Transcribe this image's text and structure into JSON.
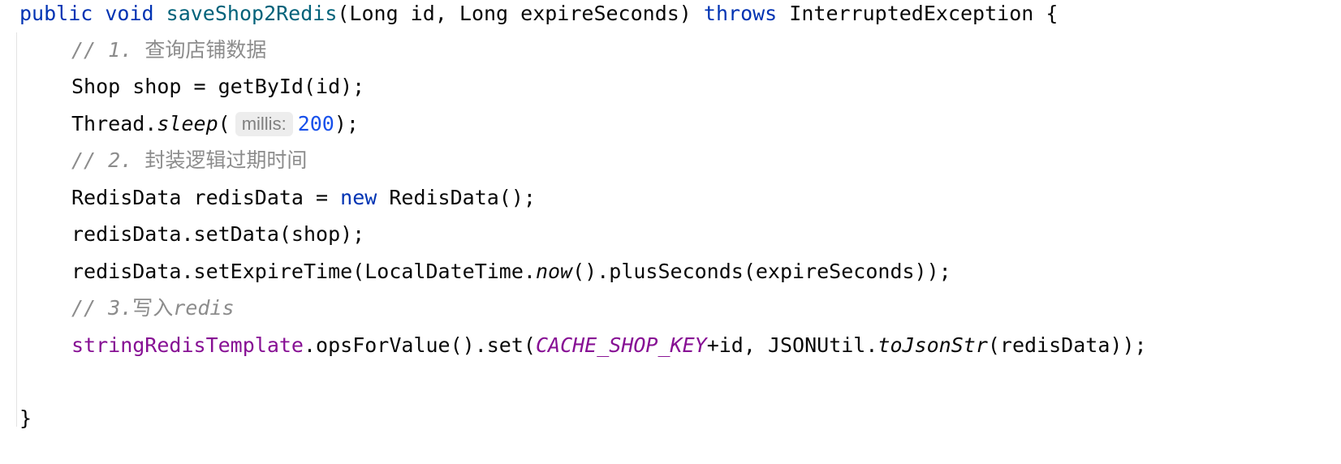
{
  "code": {
    "line1": {
      "kw_public": "public",
      "kw_void": "void",
      "method_name": "saveShop2Redis",
      "params": "(Long id, Long expireSeconds) ",
      "kw_throws": "throws",
      "rest": " InterruptedException {"
    },
    "line2": {
      "comment_prefix": "// 1. ",
      "comment_text": "查询店铺数据"
    },
    "line3": {
      "text": "Shop shop = getById(id);"
    },
    "line4": {
      "prefix": "Thread.",
      "method": "sleep",
      "open": "(",
      "hint": "millis:",
      "number": "200",
      "close": ");"
    },
    "line5": {
      "comment_prefix": "// 2. ",
      "comment_text": "封装逻辑过期时间"
    },
    "line6": {
      "prefix": "RedisData redisData = ",
      "kw_new": "new",
      "rest": " RedisData();"
    },
    "line7": {
      "text": "redisData.setData(shop);"
    },
    "line8": {
      "prefix": "redisData.setExpireTime(LocalDateTime.",
      "method": "now",
      "rest": "().plusSeconds(expireSeconds));"
    },
    "line9": {
      "comment_prefix": "// 3.",
      "comment_cjk": "写入",
      "comment_rest": "redis"
    },
    "line10": {
      "field": "stringRedisTemplate",
      "mid": ".opsForValue().set(",
      "constant": "CACHE_SHOP_KEY",
      "mid2": "+id, JSONUtil.",
      "method": "toJsonStr",
      "rest": "(redisData));"
    },
    "line12": {
      "text": "}"
    }
  }
}
